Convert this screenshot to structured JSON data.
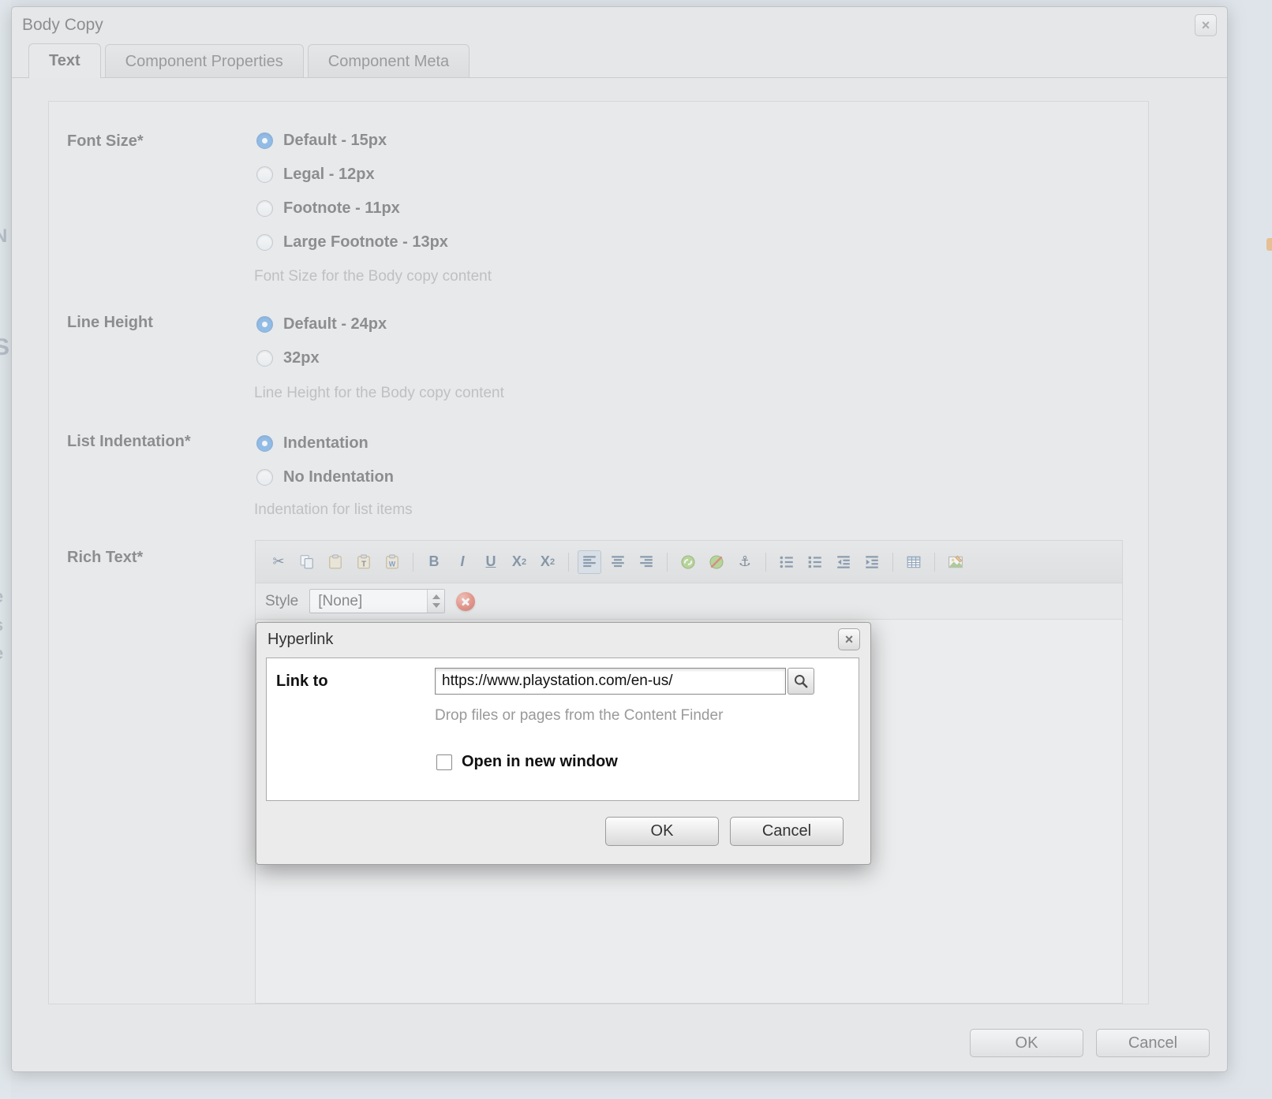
{
  "window": {
    "title": "Body Copy",
    "close_glyph": "×"
  },
  "tabs": [
    {
      "label": "Text",
      "active": true
    },
    {
      "label": "Component Properties",
      "active": false
    },
    {
      "label": "Component Meta",
      "active": false
    }
  ],
  "form": {
    "font_size": {
      "label": "Font Size*",
      "options": [
        "Default - 15px",
        "Legal - 12px",
        "Footnote - 11px",
        "Large Footnote - 13px"
      ],
      "selected": 0,
      "help": "Font Size for the Body copy content"
    },
    "line_height": {
      "label": "Line Height",
      "options": [
        "Default - 24px",
        "32px"
      ],
      "selected": 0,
      "help": "Line Height for the Body copy content"
    },
    "list_indentation": {
      "label": "List Indentation*",
      "options": [
        "Indentation",
        "No Indentation"
      ],
      "selected": 0,
      "help": "Indentation for list items"
    },
    "rich_text": {
      "label": "Rich Text*"
    }
  },
  "editor": {
    "style_label": "Style",
    "style_value": "[None]",
    "toolbar_icons": [
      "cut-icon",
      "copy-icon",
      "paste-icon",
      "paste-plain-text-icon",
      "paste-from-word-icon",
      "bold-icon",
      "italic-icon",
      "underline-icon",
      "subscript-icon",
      "superscript-icon",
      "align-left-icon",
      "align-center-icon",
      "align-right-icon",
      "link-icon",
      "unlink-icon",
      "anchor-icon",
      "bullet-list-icon",
      "numbered-list-icon",
      "outdent-icon",
      "indent-icon",
      "table-icon",
      "image-edit-icon"
    ],
    "glyphs": {
      "cut": "✂",
      "bold": "B",
      "italic": "I",
      "underline": "U",
      "script_base": "X",
      "script_small": "2",
      "anchor": "⚓",
      "paste_t": "T",
      "paste_w": "W"
    }
  },
  "hyperlink_dialog": {
    "title": "Hyperlink",
    "close_glyph": "×",
    "link_to_label": "Link to",
    "url_value": "https://www.playstation.com/en-us/",
    "help": "Drop files or pages from the Content Finder",
    "checkbox_label": "Open in new window",
    "checkbox_checked": false,
    "ok_label": "OK",
    "cancel_label": "Cancel"
  },
  "footer": {
    "ok_label": "OK",
    "cancel_label": "Cancel"
  },
  "page_edge": {
    "letters": [
      "N",
      "S",
      "e",
      "s",
      "e"
    ]
  }
}
